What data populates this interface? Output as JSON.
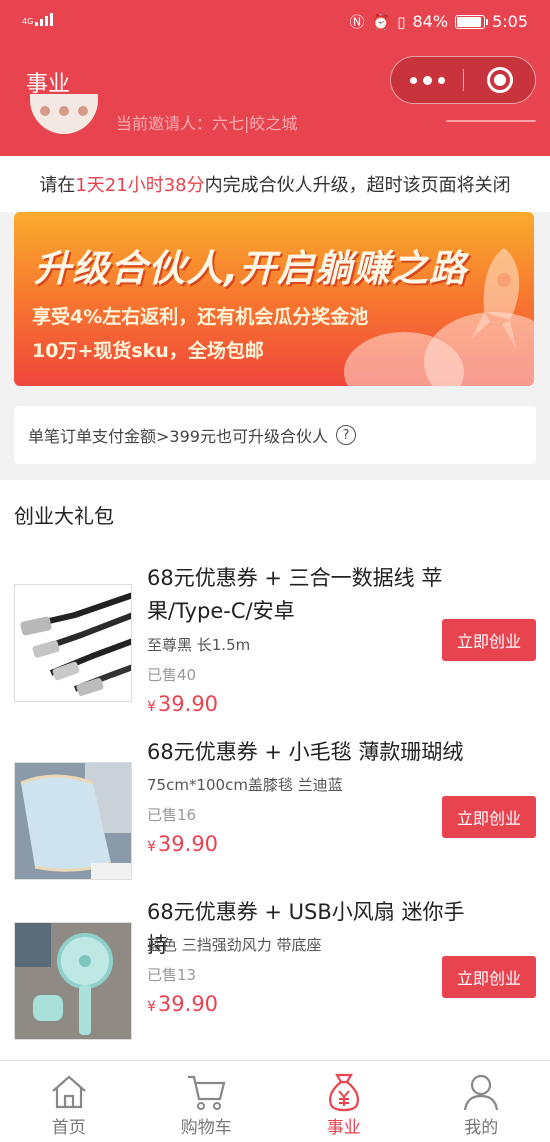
{
  "status_bar": {
    "network": "4G",
    "battery": "84%",
    "time": "5:05",
    "battery_level": 0.84
  },
  "nav": {
    "title": "事业",
    "peek_text": "当前邀请人：六七|皎之城"
  },
  "notice": {
    "prefix": "请在",
    "countdown": "1天21小时38分",
    "suffix": "内完成合伙人升级，超时该页面将关闭"
  },
  "banner": {
    "title": "升级合伙人,开启躺赚之路",
    "line1": "享受4%左右返利，还有机会瓜分奖金池",
    "line2": "10万+现货sku，全场包邮"
  },
  "tip": {
    "text": "单笔订单支付金额>399元也可升级合伙人",
    "help_glyph": "?"
  },
  "pack": {
    "title": "创业大礼包",
    "items": [
      {
        "title": "68元优惠券 + 三合一数据线 苹果/Type-C/安卓",
        "spec": "至尊黑 长1.5m",
        "sold": "已售40",
        "currency": "¥",
        "price": "39.90",
        "button": "立即创业"
      },
      {
        "title": "68元优惠券 + 小毛毯 薄款珊瑚绒",
        "spec": "75cm*100cm盖膝毯 兰迪蓝",
        "sold": "已售16",
        "currency": "¥",
        "price": "39.90",
        "button": "立即创业"
      },
      {
        "title": "68元优惠券 + USB小风扇 迷你手持",
        "spec": "蓝色 三挡强劲风力 带底座",
        "sold": "已售13",
        "currency": "¥",
        "price": "39.90",
        "button": "立即创业"
      }
    ]
  },
  "tabs": [
    {
      "label": "首页",
      "icon": "home-icon"
    },
    {
      "label": "购物车",
      "icon": "cart-icon"
    },
    {
      "label": "事业",
      "icon": "money-bag-icon",
      "active": true
    },
    {
      "label": "我的",
      "icon": "user-icon"
    }
  ],
  "colors": {
    "brand": "#e84450",
    "banner_top": "#f9ac2e",
    "banner_bottom": "#f0463c"
  }
}
